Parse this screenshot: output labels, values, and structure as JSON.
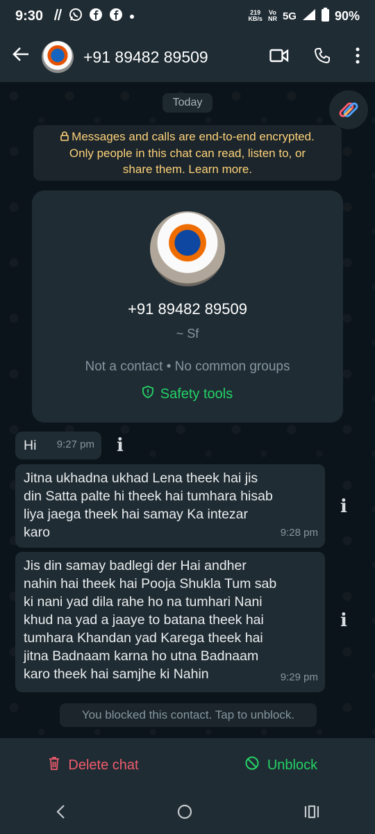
{
  "status_bar": {
    "time": "9:30",
    "speed_top": "219",
    "speed_unit": "KB/s",
    "volte_top": "Vo",
    "volte_bottom": "NR",
    "network": "5G",
    "battery": "90%"
  },
  "header": {
    "title": "+91 89482 89509",
    "icons": [
      "back-arrow-icon",
      "video-call-icon",
      "voice-call-icon",
      "more-options-icon"
    ]
  },
  "chat": {
    "date_chip": "Today",
    "encryption_lines": [
      "Messages and calls are end-to-end encrypted.",
      "Only people in this chat can read, listen to, or",
      "share them. Learn more."
    ],
    "profile_card": {
      "phone": "+91 89482 89509",
      "name": "~ Sf",
      "info": "Not a contact • No common groups",
      "safety": "Safety tools"
    },
    "messages": [
      {
        "lines": [
          "Hi"
        ],
        "time": "9:27 pm"
      },
      {
        "lines": [
          "Jitna ukhadna ukhad Lena theek hai jis",
          "din Satta palte hi theek hai tumhara hisab",
          "liya jaega theek hai samay Ka intezar",
          "karo"
        ],
        "time": "9:28 pm"
      },
      {
        "lines": [
          "Jis din samay badlegi der Hai andher",
          "nahin hai theek hai Pooja Shukla Tum sab",
          "ki nani yad dila rahe ho na tumhari Nani",
          "khud na yad a jaaye to batana theek hai",
          "tumhara Khandan yad Karega theek hai",
          "jitna Badnaam karna ho utna Badnaam",
          "karo theek hai samjhe ki Nahin"
        ],
        "time": "9:29 pm"
      }
    ],
    "blocked_notice": "You blocked this contact. Tap to unblock."
  },
  "actions": {
    "delete_label": "Delete chat",
    "unblock_label": "Unblock"
  },
  "colors": {
    "background": "#0b141a",
    "bar": "#1f2c34",
    "bubble": "#202c33",
    "accent_green": "#25d366",
    "danger_red": "#f15c6d",
    "encryption_yellow": "#ffd279"
  }
}
